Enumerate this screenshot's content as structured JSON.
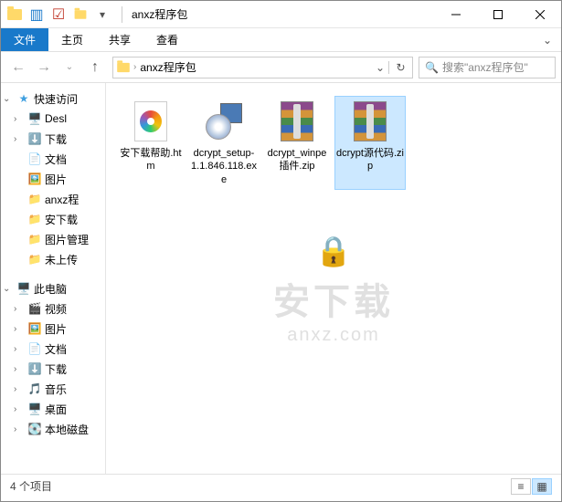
{
  "window": {
    "title": "anxz程序包"
  },
  "ribbon": {
    "file": "文件",
    "tabs": [
      "主页",
      "共享",
      "查看"
    ]
  },
  "address": {
    "crumb": "anxz程序包",
    "search_placeholder": "搜索\"anxz程序包\""
  },
  "nav": {
    "quick_access": "快速访问",
    "quick_items": [
      "Desl",
      "下载",
      "文档",
      "图片",
      "anxz程",
      "安下载",
      "图片管理",
      "未上传"
    ],
    "this_pc": "此电脑",
    "pc_items": [
      "视频",
      "图片",
      "文档",
      "下载",
      "音乐",
      "桌面",
      "本地磁盘"
    ]
  },
  "files": [
    {
      "name": "安下载帮助.htm",
      "type": "htm",
      "selected": false
    },
    {
      "name": "dcrypt_setup-1.1.846.118.exe",
      "type": "exe",
      "selected": false
    },
    {
      "name": "dcrypt_winpe插件.zip",
      "type": "zip",
      "selected": false
    },
    {
      "name": "dcrypt源代码.zip",
      "type": "zip",
      "selected": true
    }
  ],
  "watermark": {
    "text": "安下载",
    "url": "anxz.com"
  },
  "status": {
    "count": "4 个项目"
  }
}
